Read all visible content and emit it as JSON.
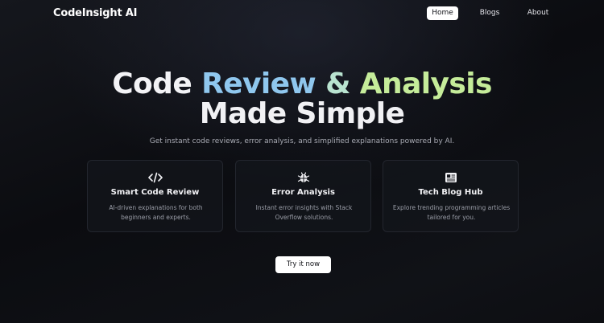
{
  "nav": {
    "brand": "CodeInsight AI",
    "links": [
      {
        "label": "Home",
        "active": true
      },
      {
        "label": "Blogs",
        "active": false
      },
      {
        "label": "About",
        "active": false
      }
    ]
  },
  "hero": {
    "line1": {
      "code": "Code",
      "review": "Review",
      "amp": "&",
      "analysis": "Analysis"
    },
    "line2": "Made Simple",
    "subtitle": "Get instant code reviews, error analysis, and simplified explanations powered by AI."
  },
  "features": [
    {
      "icon": "code-icon",
      "title": "Smart Code Review",
      "description": "AI-driven explanations for both beginners and experts."
    },
    {
      "icon": "bug-icon",
      "title": "Error Analysis",
      "description": "Instant error insights with Stack Overflow solutions."
    },
    {
      "icon": "newspaper-icon",
      "title": "Tech Blog Hub",
      "description": "Explore trending programming articles tailored for you."
    }
  ],
  "cta": {
    "label": "Try it now"
  },
  "colors": {
    "background": "#0b0c10",
    "review_gradient": "#8fc7ee",
    "amp_gradient": "#b9e3d0",
    "analysis_gradient": "#c5ec9a",
    "button_bg": "#ffffff"
  }
}
